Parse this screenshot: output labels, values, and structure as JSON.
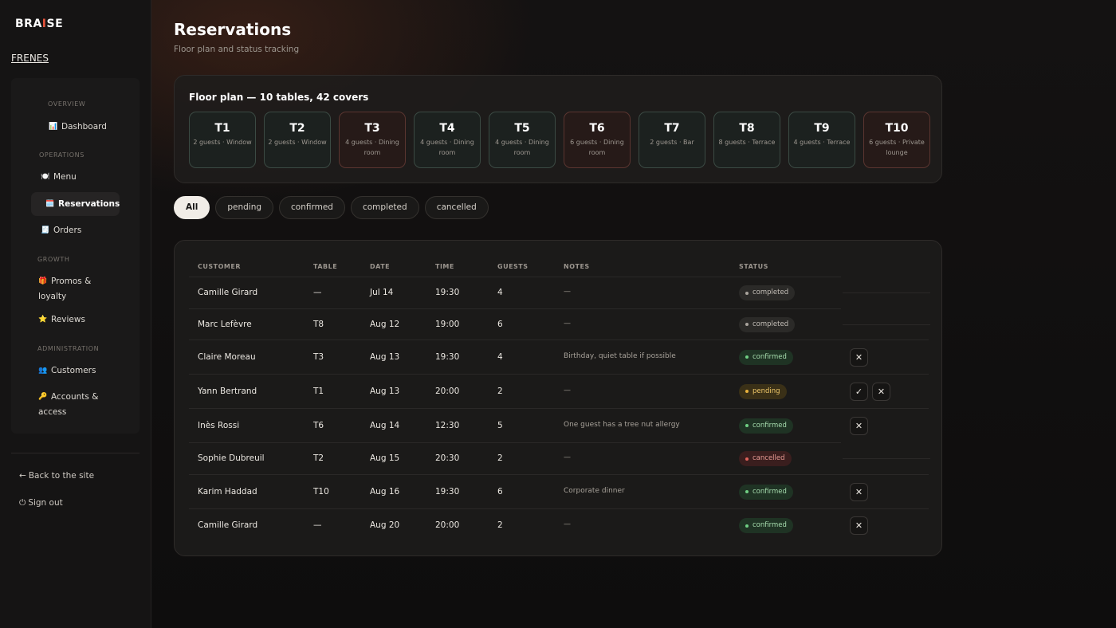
{
  "sidebar": {
    "brand": {
      "pre": "BRA",
      "accent": "I",
      "post": "SE"
    },
    "org": "FRENES",
    "groups": {
      "overview": "OVERVIEW",
      "operations": "OPERATIONS",
      "growth": "GROWTH",
      "administration": "ADMINISTRATION"
    },
    "items": [
      {
        "icon": "📊",
        "label": "Dashboard"
      },
      {
        "icon": "🍽️",
        "label": "Menu"
      },
      {
        "icon": "🗓️",
        "label": "Reservations"
      },
      {
        "icon": "🧾",
        "label": "Orders"
      },
      {
        "icon": "🎁",
        "label": "Promos &",
        "label2": "loyalty"
      },
      {
        "icon": "⭐",
        "label": "Reviews"
      },
      {
        "icon": "👥",
        "label": "Customers"
      },
      {
        "icon": "🔑",
        "label": "Accounts &",
        "label2": "access"
      }
    ],
    "back": {
      "icon": "←",
      "label": "Back to the site"
    },
    "signout": {
      "icon": "⏻",
      "label": "Sign out"
    }
  },
  "header": {
    "title": "Reservations",
    "subtitle": "Floor plan and status tracking"
  },
  "floor": {
    "title": "Floor plan — 10 tables, 42 covers",
    "tables": [
      {
        "name": "T1",
        "info": "2 guests · Window",
        "accent": "green"
      },
      {
        "name": "T2",
        "info": "2 guests · Window",
        "accent": "green"
      },
      {
        "name": "T3",
        "info": "4 guests · Dining room",
        "accent": "red"
      },
      {
        "name": "T4",
        "info": "4 guests · Dining room",
        "accent": "green"
      },
      {
        "name": "T5",
        "info": "4 guests · Dining room",
        "accent": "green"
      },
      {
        "name": "T6",
        "info": "6 guests · Dining room",
        "accent": "red"
      },
      {
        "name": "T7",
        "info": "2 guests · Bar",
        "accent": "green"
      },
      {
        "name": "T8",
        "info": "8 guests · Terrace",
        "accent": "green"
      },
      {
        "name": "T9",
        "info": "4 guests · Terrace",
        "accent": "green"
      },
      {
        "name": "T10",
        "info": "6 guests · Private lounge",
        "accent": "red"
      }
    ]
  },
  "filters": [
    "All",
    "pending",
    "confirmed",
    "completed",
    "cancelled"
  ],
  "columns": [
    "CUSTOMER",
    "TABLE",
    "DATE",
    "TIME",
    "GUESTS",
    "NOTES",
    "STATUS"
  ],
  "reservations": [
    {
      "customer": "Camille Girard",
      "table": "—",
      "date": "Jul 14",
      "time": "19:30",
      "guests": "4",
      "notes": "—",
      "status": "completed",
      "actions": []
    },
    {
      "customer": "Marc Lefèvre",
      "table": "T8",
      "date": "Aug 12",
      "time": "19:00",
      "guests": "6",
      "notes": "—",
      "status": "completed",
      "actions": []
    },
    {
      "customer": "Claire Moreau",
      "table": "T3",
      "date": "Aug 13",
      "time": "19:30",
      "guests": "4",
      "notes": "Birthday, quiet table if possible",
      "status": "confirmed",
      "actions": [
        "✕"
      ]
    },
    {
      "customer": "Yann Bertrand",
      "table": "T1",
      "date": "Aug 13",
      "time": "20:00",
      "guests": "2",
      "notes": "—",
      "status": "pending",
      "actions": [
        "✓",
        "✕"
      ]
    },
    {
      "customer": "Inès Rossi",
      "table": "T6",
      "date": "Aug 14",
      "time": "12:30",
      "guests": "5",
      "notes": "One guest has a tree nut allergy",
      "status": "confirmed",
      "actions": [
        "✕"
      ]
    },
    {
      "customer": "Sophie Dubreuil",
      "table": "T2",
      "date": "Aug 15",
      "time": "20:30",
      "guests": "2",
      "notes": "—",
      "status": "cancelled",
      "actions": []
    },
    {
      "customer": "Karim Haddad",
      "table": "T10",
      "date": "Aug 16",
      "time": "19:30",
      "guests": "6",
      "notes": "Corporate dinner",
      "status": "confirmed",
      "actions": [
        "✕"
      ]
    },
    {
      "customer": "Camille Girard",
      "table": "—",
      "date": "Aug 20",
      "time": "20:00",
      "guests": "2",
      "notes": "—",
      "status": "confirmed",
      "actions": [
        "✕"
      ]
    }
  ]
}
